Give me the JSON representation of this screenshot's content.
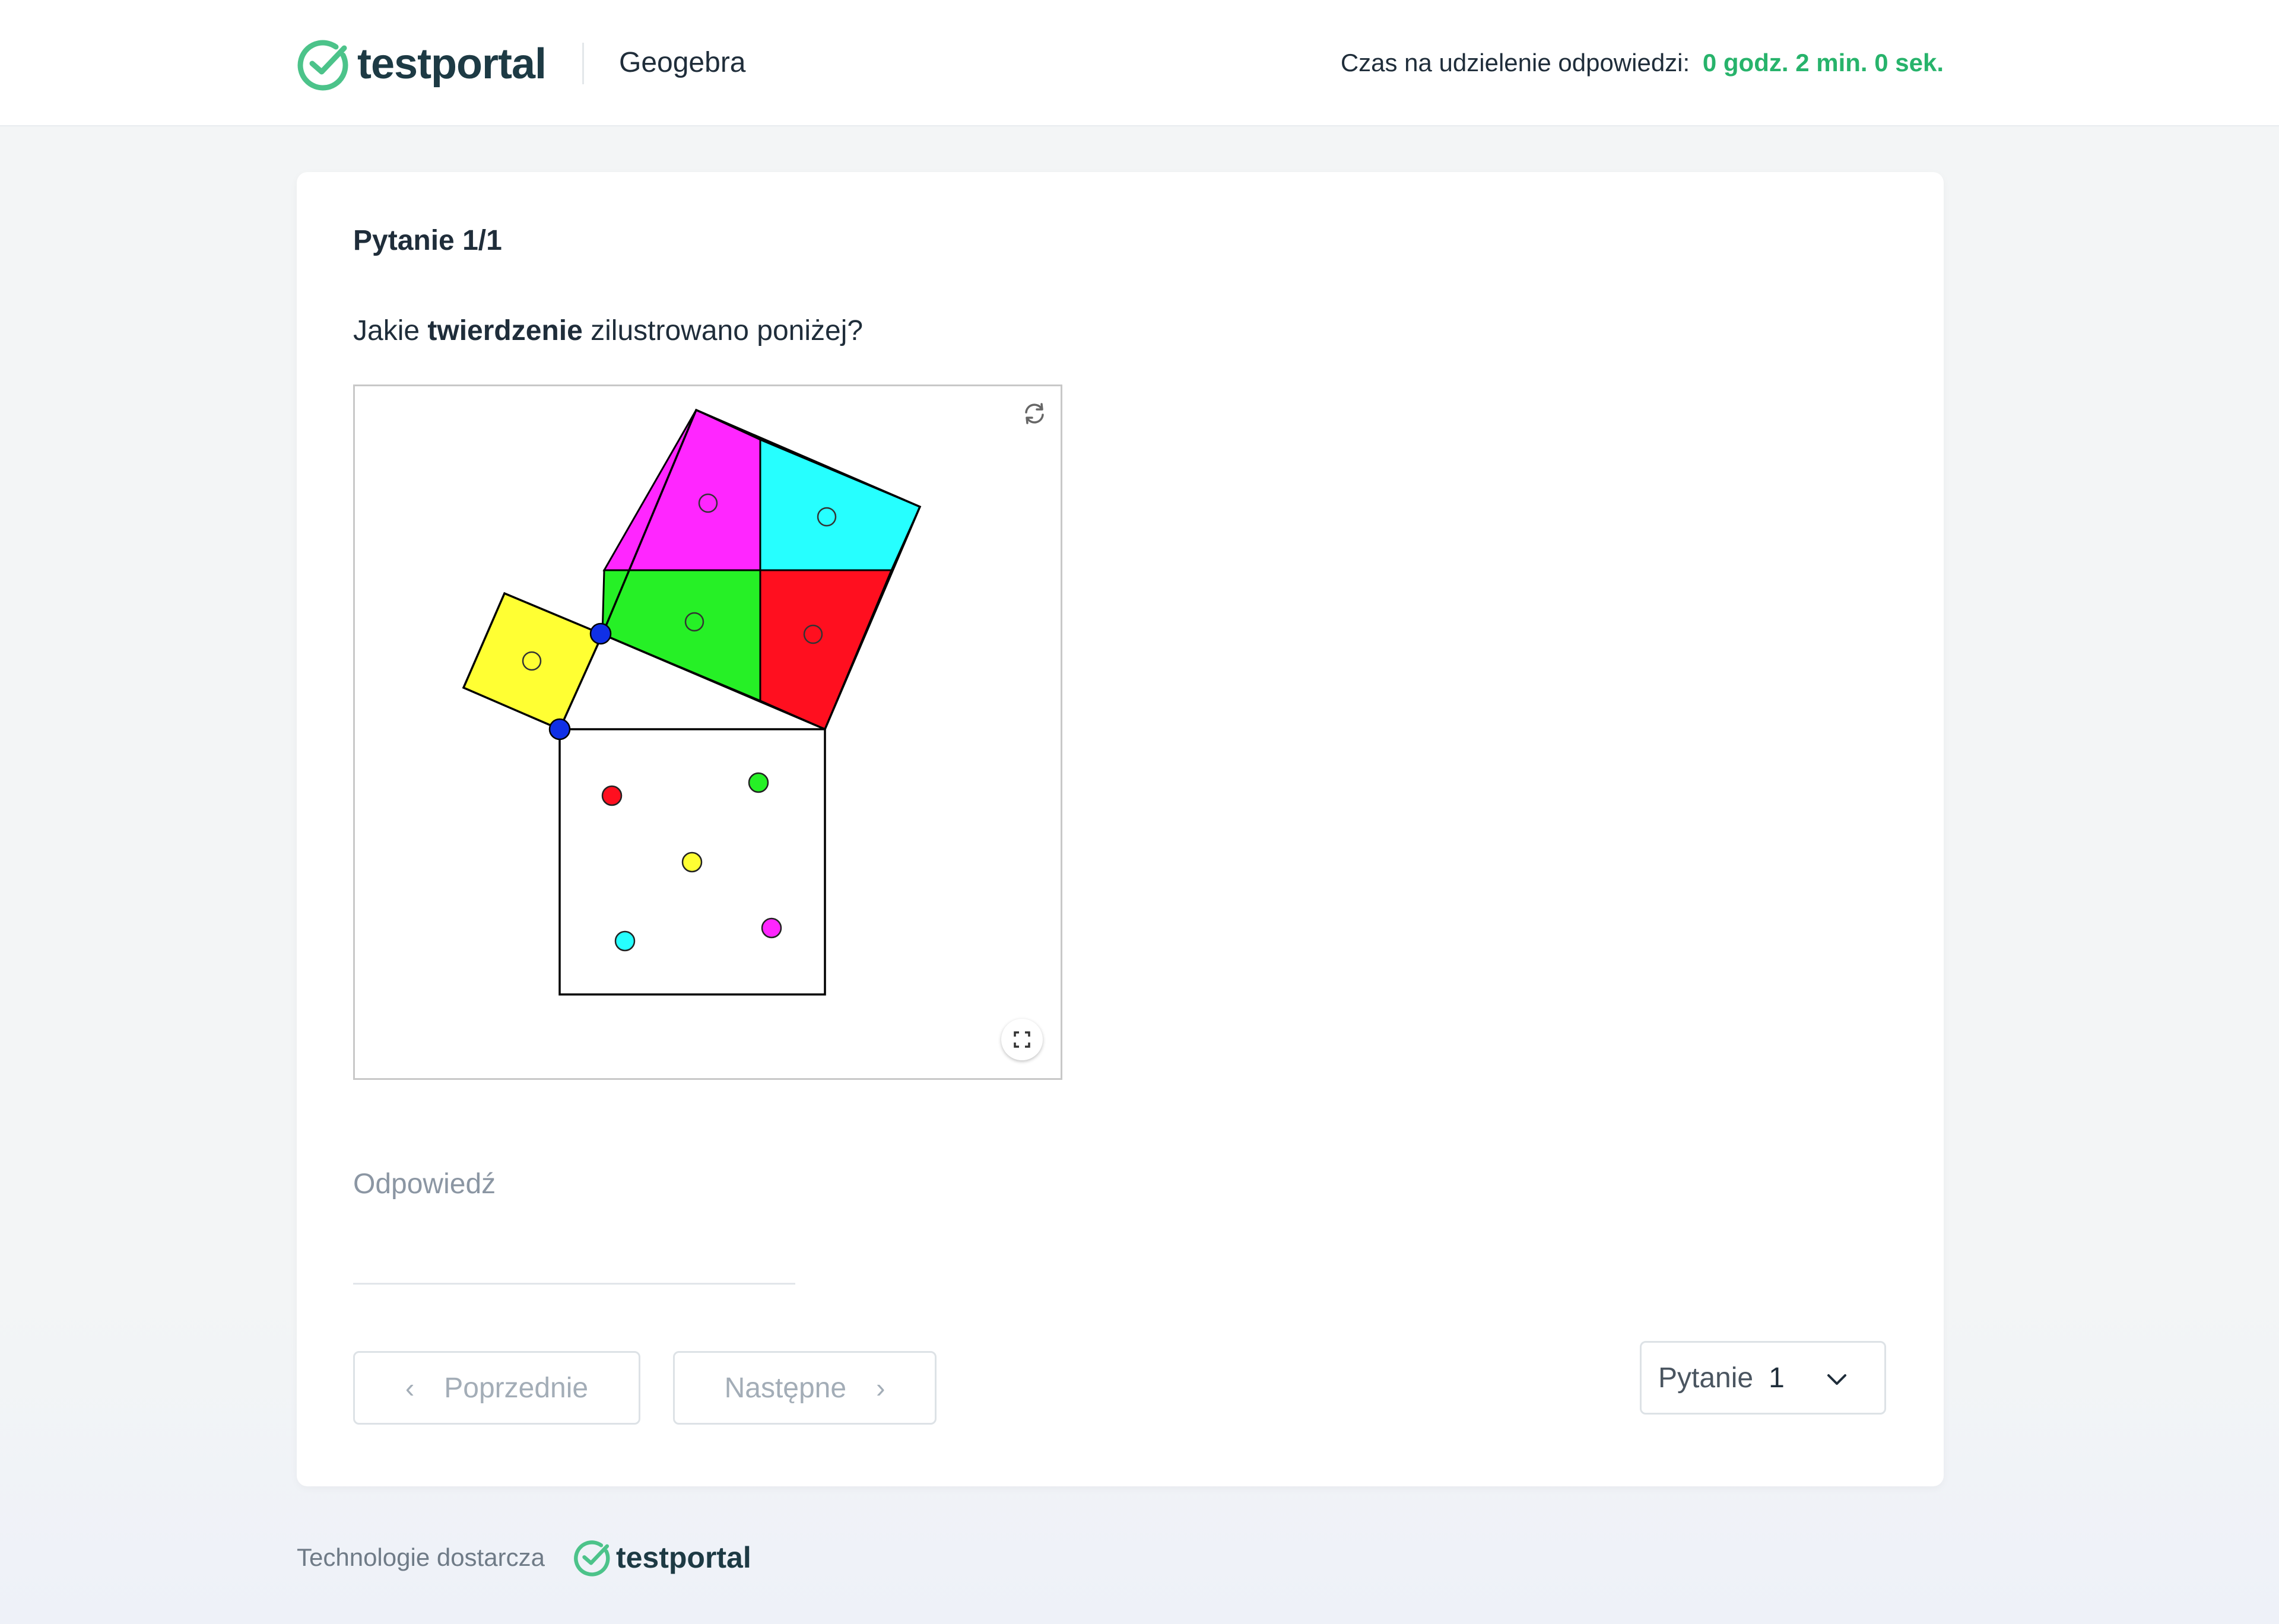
{
  "header": {
    "brand": "testportal",
    "test_name": "Geogebra",
    "timer_label": "Czas na udzielenie odpowiedzi:",
    "timer_value": "0 godz. 2 min. 0 sek."
  },
  "question": {
    "number_label": "Pytanie 1/1",
    "text_before": "Jakie ",
    "text_bold": "twierdzenie",
    "text_after": " zilustrowano poniżej?"
  },
  "applet": {
    "refresh_icon": "refresh-icon",
    "fullscreen_icon": "fullscreen-icon",
    "piece_colors": {
      "magenta": "#ff26ff",
      "cyan": "#26ffff",
      "green": "#26f026",
      "red": "#ff0f1f",
      "yellow": "#ffff33",
      "vertex": "#1030e6"
    }
  },
  "answer": {
    "label": "Odpowiedź",
    "value": ""
  },
  "navigation": {
    "prev_label": "Poprzednie",
    "next_label": "Następne",
    "select_label": "Pytanie",
    "select_value": "1"
  },
  "footer": {
    "text": "Technologie dostarcza",
    "brand": "testportal"
  },
  "colors": {
    "accent": "#27b36b",
    "brand_dark": "#1d3a44"
  }
}
